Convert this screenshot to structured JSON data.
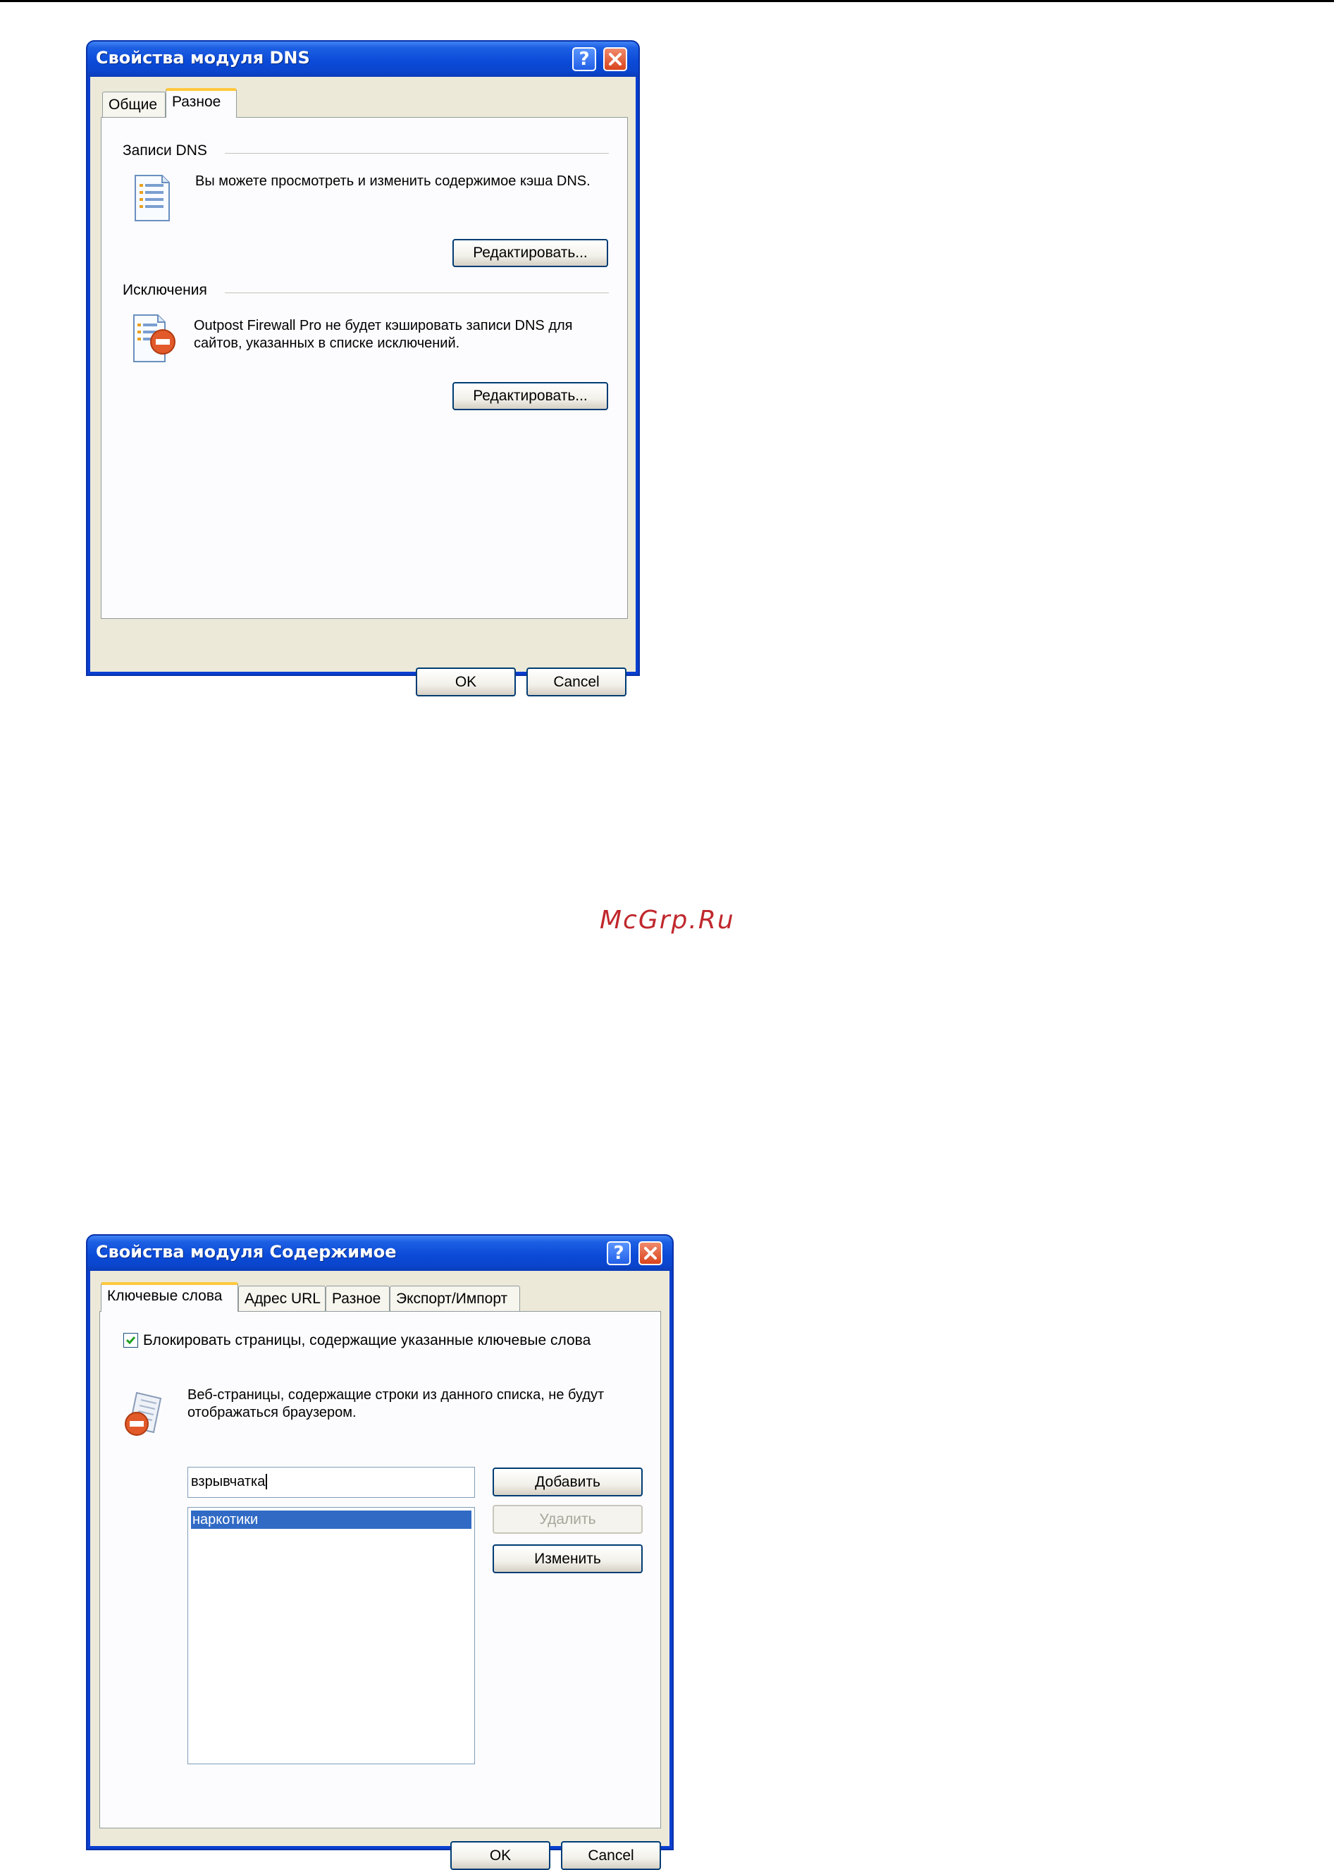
{
  "watermark": "McGrp.Ru",
  "dns_dialog": {
    "title": "Свойства модуля DNS",
    "help_button": "?",
    "tabs": [
      "Общие",
      "Разное"
    ],
    "active_tab": "Разное",
    "dns_records": {
      "heading": "Записи DNS",
      "description": "Вы можете просмотреть и изменить содержимое кэша DNS.",
      "edit_button": "Редактировать..."
    },
    "exceptions": {
      "heading": "Исключения",
      "description": "Outpost Firewall Pro не будет кэшировать записи DNS для сайтов, указанных в списке исключений.",
      "edit_button": "Редактировать..."
    },
    "ok_button": "OK",
    "cancel_button": "Cancel"
  },
  "content_dialog": {
    "title": "Свойства модуля Содержимое",
    "help_button": "?",
    "tabs": [
      "Ключевые слова",
      "Адрес URL",
      "Разное",
      "Экспорт/Импорт"
    ],
    "active_tab": "Ключевые слова",
    "block_checkbox": {
      "label": "Блокировать страницы, содержащие указанные ключевые слова",
      "checked": true
    },
    "description": "Веб-страницы, содержащие строки из данного списка, не будут отображаться браузером.",
    "keyword_input_value": "взрывчатка",
    "keywords": [
      "наркотики"
    ],
    "buttons": {
      "add": "Добавить",
      "remove": "Удалить",
      "edit": "Изменить"
    },
    "ok_button": "OK",
    "cancel_button": "Cancel"
  }
}
